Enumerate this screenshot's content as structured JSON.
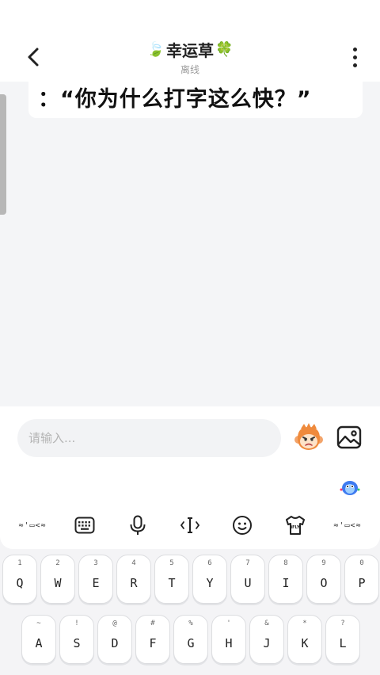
{
  "header": {
    "title": "幸运草",
    "title_prefix_icon": "leaf-emoji",
    "title_suffix_icon": "clover-emoji",
    "status": "离线",
    "back_icon": "chevron-left-icon",
    "more_icon": "more-vertical-icon"
  },
  "chat": {
    "message_text": "：“你为什么打字这么快？”"
  },
  "composer": {
    "placeholder": "请输入...",
    "emoji_icon": "monkey-emoji-icon",
    "image_icon": "image-icon"
  },
  "keyboard": {
    "toolbar": {
      "left_label": "≈'▭<≈",
      "right_label": "≈'▭<≈",
      "icons": [
        "keyboard-icon",
        "microphone-icon",
        "text-cursor-icon",
        "smiley-icon",
        "ifly-shirt-icon"
      ],
      "ifly_label": "iFLY"
    },
    "row1": [
      {
        "sub": "1",
        "main": "Q"
      },
      {
        "sub": "2",
        "main": "W"
      },
      {
        "sub": "3",
        "main": "E"
      },
      {
        "sub": "4",
        "main": "R"
      },
      {
        "sub": "5",
        "main": "T"
      },
      {
        "sub": "6",
        "main": "Y"
      },
      {
        "sub": "7",
        "main": "U"
      },
      {
        "sub": "8",
        "main": "I"
      },
      {
        "sub": "9",
        "main": "O"
      },
      {
        "sub": "0",
        "main": "P"
      }
    ],
    "row2": [
      {
        "sub": "~",
        "main": "A"
      },
      {
        "sub": "!",
        "main": "S"
      },
      {
        "sub": "@",
        "main": "D"
      },
      {
        "sub": "#",
        "main": "F"
      },
      {
        "sub": "%",
        "main": "G"
      },
      {
        "sub": "'",
        "main": "H"
      },
      {
        "sub": "&",
        "main": "J"
      },
      {
        "sub": "*",
        "main": "K"
      },
      {
        "sub": "?",
        "main": "L"
      }
    ]
  }
}
